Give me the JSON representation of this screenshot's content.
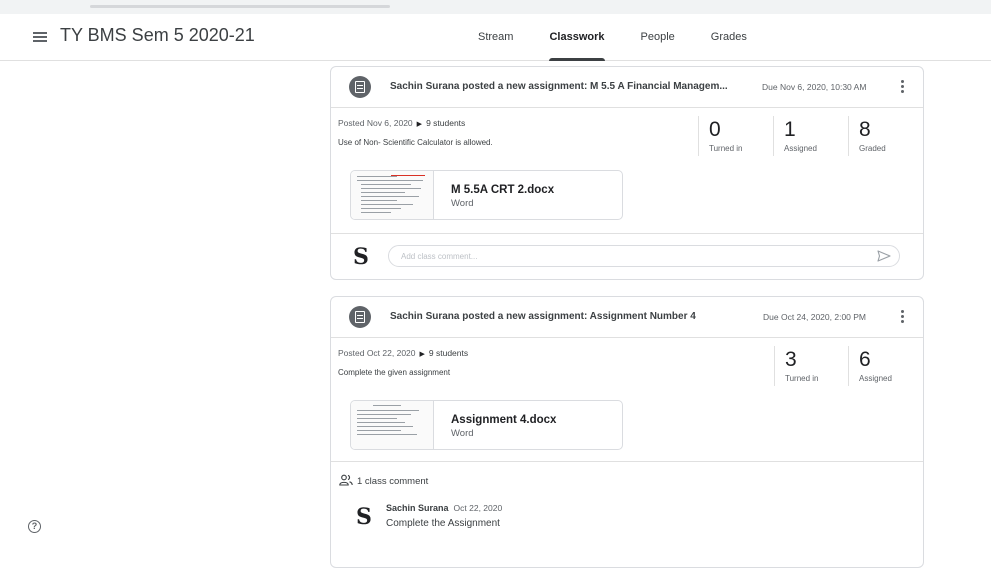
{
  "header": {
    "class_title": "TY BMS Sem 5 2020-21",
    "tabs": [
      {
        "label": "Stream",
        "active": false
      },
      {
        "label": "Classwork",
        "active": true
      },
      {
        "label": "People",
        "active": false
      },
      {
        "label": "Grades",
        "active": false
      }
    ]
  },
  "assignments": [
    {
      "title": "Sachin Surana posted a new assignment: M 5.5 A Financial Managem...",
      "due": "Due Nov 6, 2020, 10:30 AM",
      "posted": "Posted Nov 6, 2020",
      "students": "9 students",
      "description": "Use of Non- Scientific Calculator is allowed.",
      "stats": [
        {
          "value": "0",
          "label": "Turned in"
        },
        {
          "value": "1",
          "label": "Assigned"
        },
        {
          "value": "8",
          "label": "Graded"
        }
      ],
      "attachment": {
        "name": "M 5.5A CRT 2.docx",
        "type": "Word"
      },
      "comment_placeholder": "Add class comment...",
      "avatar_letter": "S"
    },
    {
      "title": "Sachin Surana posted a new assignment: Assignment Number 4",
      "due": "Due Oct 24, 2020, 2:00 PM",
      "posted": "Posted Oct 22, 2020",
      "students": "9 students",
      "description": "Complete the given assignment",
      "stats": [
        {
          "value": "3",
          "label": "Turned in"
        },
        {
          "value": "6",
          "label": "Assigned"
        }
      ],
      "attachment": {
        "name": "Assignment 4.docx",
        "type": "Word"
      },
      "comments_count": "1 class comment",
      "comment": {
        "avatar_letter": "S",
        "author": "Sachin Surana",
        "date": "Oct 22, 2020",
        "text": "Complete the Assignment"
      }
    }
  ],
  "icons": {
    "menu": "hamburger-menu-icon",
    "help": "help-circle-icon",
    "help_glyph": "?",
    "assignment": "assignment-icon",
    "more": "more-vert-icon",
    "send": "send-icon",
    "people": "people-icon"
  },
  "colors": {
    "text": "#3c4043",
    "secondary": "#5f6368",
    "border": "#dadce0"
  }
}
